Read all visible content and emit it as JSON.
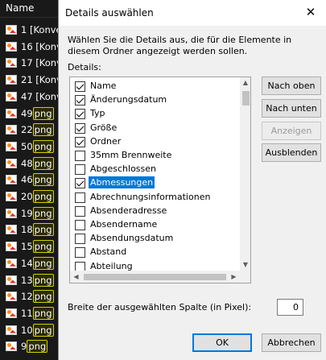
{
  "explorer": {
    "header": "Name",
    "rows": [
      {
        "text": "1 [Konve",
        "tag": ""
      },
      {
        "text": "16 [Konv",
        "tag": ""
      },
      {
        "text": "17 [Konv",
        "tag": ""
      },
      {
        "text": "21 [Konv",
        "tag": ""
      },
      {
        "text": "47 [Konv",
        "tag": ""
      },
      {
        "text": "49",
        "tag": "png"
      },
      {
        "text": "22",
        "tag": "png"
      },
      {
        "text": "50",
        "tag": "png"
      },
      {
        "text": "48",
        "tag": "png"
      },
      {
        "text": "46",
        "tag": "png"
      },
      {
        "text": "20",
        "tag": "png"
      },
      {
        "text": "19",
        "tag": "png"
      },
      {
        "text": "18",
        "tag": "png"
      },
      {
        "text": "15",
        "tag": "png"
      },
      {
        "text": "14",
        "tag": "png"
      },
      {
        "text": "13",
        "tag": "png"
      },
      {
        "text": "12",
        "tag": "png"
      },
      {
        "text": "11",
        "tag": "png"
      },
      {
        "text": "10",
        "tag": "png"
      },
      {
        "text": "9",
        "tag": "png"
      }
    ]
  },
  "dialog": {
    "title": "Details auswählen",
    "close_glyph": "✕",
    "description": "Wählen Sie die Details aus, die für die Elemente in diesem Ordner angezeigt werden sollen.",
    "details_label": "Details:",
    "items": [
      {
        "label": "Name",
        "checked": true,
        "selected": false
      },
      {
        "label": "Änderungsdatum",
        "checked": true,
        "selected": false
      },
      {
        "label": "Typ",
        "checked": true,
        "selected": false
      },
      {
        "label": "Größe",
        "checked": true,
        "selected": false
      },
      {
        "label": "Ordner",
        "checked": true,
        "selected": false
      },
      {
        "label": "35mm Brennweite",
        "checked": false,
        "selected": false
      },
      {
        "label": "Abgeschlossen",
        "checked": false,
        "selected": false
      },
      {
        "label": "Abmessungen",
        "checked": true,
        "selected": true
      },
      {
        "label": "Abrechnungsinformationen",
        "checked": false,
        "selected": false
      },
      {
        "label": "Absenderadresse",
        "checked": false,
        "selected": false
      },
      {
        "label": "Absendername",
        "checked": false,
        "selected": false
      },
      {
        "label": "Absendungsdatum",
        "checked": false,
        "selected": false
      },
      {
        "label": "Abstand",
        "checked": false,
        "selected": false
      },
      {
        "label": "Abteilung",
        "checked": false,
        "selected": false
      }
    ],
    "buttons": {
      "move_up": "Nach oben",
      "move_down": "Nach unten",
      "show": "Anzeigen",
      "hide": "Ausblenden",
      "ok": "OK",
      "cancel": "Abbrechen"
    },
    "width_label": "Breite der ausgewählten Spalte (in Pixel):",
    "width_value": "0"
  }
}
